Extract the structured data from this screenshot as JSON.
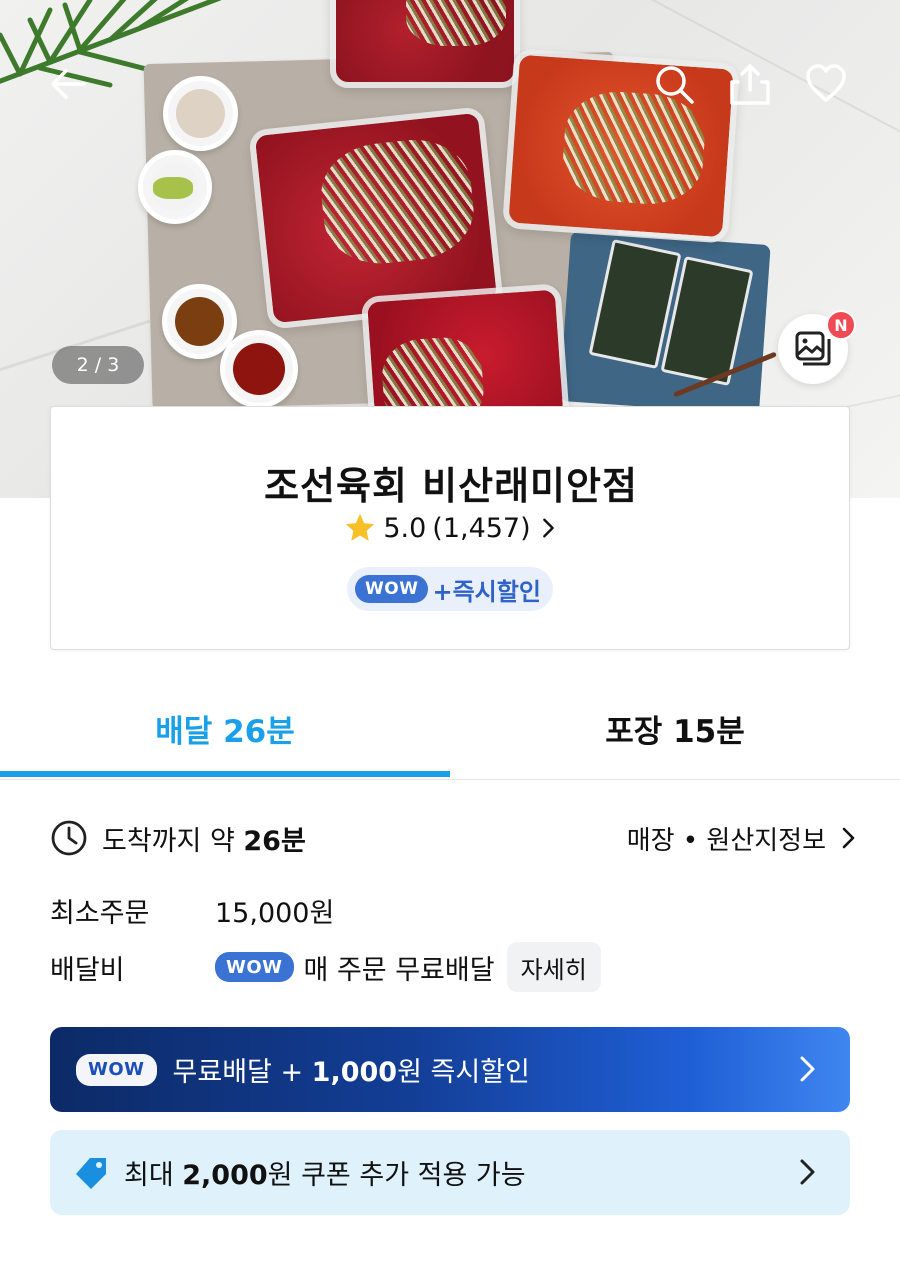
{
  "hero": {
    "image_counter": "2 / 3",
    "photo_badge": "N"
  },
  "store": {
    "name": "조선육회 비산래미안점",
    "rating": "5.0",
    "review_count": "(1,457)",
    "wow_label": "WOW",
    "wow_benefit": "+즉시할인"
  },
  "tabs": [
    {
      "label": "배달 26분",
      "active": true
    },
    {
      "label": "포장 15분",
      "active": false
    }
  ],
  "delivery": {
    "eta_prefix": "도착까지 약 ",
    "eta_value": "26분",
    "store_info_link": "매장 • 원산지정보",
    "min_order_label": "최소주문",
    "min_order_value": "15,000원",
    "fee_label": "배달비",
    "fee_wow": "WOW",
    "fee_value": "매 주문 무료배달",
    "detail_button": "자세히"
  },
  "wow_banner": {
    "badge": "WOW",
    "text_prefix": "무료배달 + ",
    "text_bold": "1,000",
    "text_suffix": "원 즉시할인"
  },
  "coupon_banner": {
    "text_prefix": "최대 ",
    "text_bold": "2,000",
    "text_suffix": "원 쿠폰 추가 적용 가능"
  },
  "colors": {
    "accent": "#1aa0e8",
    "wow_blue": "#3a73d4",
    "banner_dark": "#0c2a66",
    "banner_light": "#3f86f0",
    "coupon_bg": "#dff1fb",
    "star": "#f6c026",
    "badge_red": "#f04b55"
  },
  "icons": [
    "back-arrow-icon",
    "search-icon",
    "share-icon",
    "heart-icon",
    "photo-gallery-icon",
    "star-icon",
    "chevron-right-icon",
    "clock-icon",
    "coupon-tag-icon"
  ]
}
